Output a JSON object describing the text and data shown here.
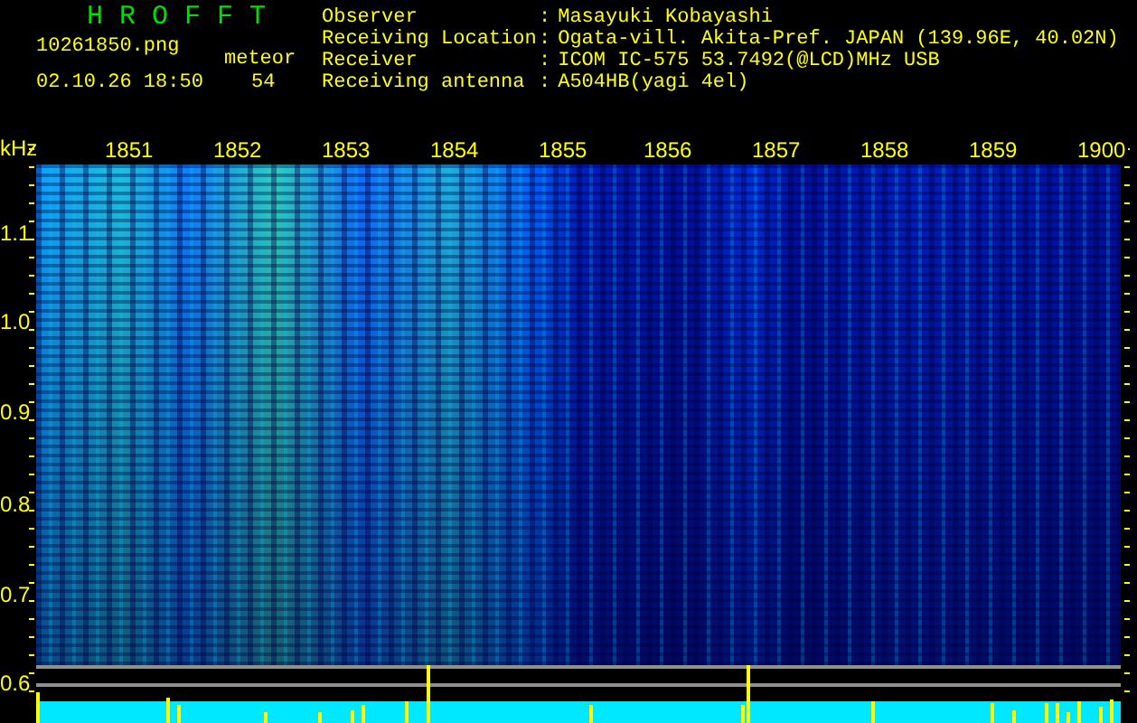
{
  "title": "H R O F F T",
  "file": "10261850.png",
  "datetime": "02.10.26 18:50",
  "count_label": "meteor",
  "count": "54",
  "info": [
    {
      "label": "Observer",
      "separator": ":",
      "value": "Masayuki Kobayashi"
    },
    {
      "label": "Receiving Location",
      "separator": ":",
      "value": "Ogata-vill. Akita-Pref. JAPAN (139.96E, 40.02N)"
    },
    {
      "label": "Receiver",
      "separator": ":",
      "value": "ICOM IC-575 53.7492(@LCD)MHz USB"
    },
    {
      "label": "Receiving antenna",
      "separator": ":",
      "value": "A504HB(yagi 4el)"
    }
  ],
  "y_unit": "kHz",
  "y_labels": [
    "1.1",
    "1.0",
    "0.9",
    "0.8",
    "0.7",
    "0.6"
  ],
  "time_labels": [
    "1851",
    "1852",
    "1853",
    "1854",
    "1855",
    "1856",
    "1857",
    "1858",
    "1859",
    "1900"
  ]
}
